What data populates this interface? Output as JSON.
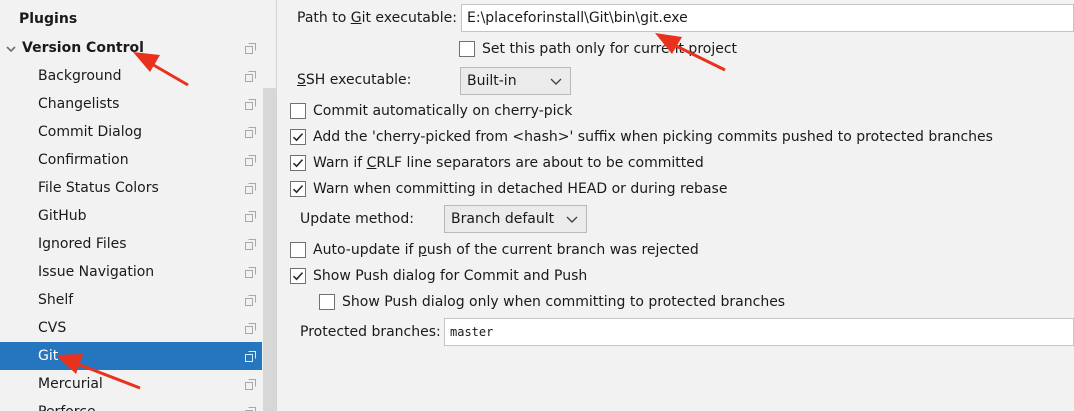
{
  "sidebar": {
    "plugins_label": "Plugins",
    "version_control_label": "Version Control",
    "items": [
      {
        "label": "Background"
      },
      {
        "label": "Changelists"
      },
      {
        "label": "Commit Dialog"
      },
      {
        "label": "Confirmation"
      },
      {
        "label": "File Status Colors"
      },
      {
        "label": "GitHub"
      },
      {
        "label": "Ignored Files"
      },
      {
        "label": "Issue Navigation"
      },
      {
        "label": "Shelf"
      },
      {
        "label": "CVS"
      },
      {
        "label": "Git",
        "selected": true
      },
      {
        "label": "Mercurial"
      },
      {
        "label": "Perforce"
      }
    ]
  },
  "git": {
    "path_label_prefix": "Path to ",
    "path_label_mnemonic": "G",
    "path_label_suffix": "it executable:",
    "path_value": "E:\\placeforinstall\\Git\\bin\\git.exe",
    "path_current_project_only": {
      "label": "Set this path only for current project",
      "checked": false
    },
    "ssh_label_mnemonic": "S",
    "ssh_label_suffix": "SH executable:",
    "ssh_value": "Built-in",
    "commit_auto_cherry_pick": {
      "label": "Commit automatically on cherry-pick",
      "checked": false
    },
    "cherry_picked_suffix": {
      "label": "Add the 'cherry-picked from <hash>' suffix when picking commits pushed to protected branches",
      "checked": true
    },
    "crlf_warn": {
      "label_prefix": "Warn if ",
      "label_mnemonic": "C",
      "label_suffix": "RLF line separators are about to be committed",
      "checked": true
    },
    "detached_head_warn": {
      "label": "Warn when committing in detached HEAD or during rebase",
      "checked": true
    },
    "update_method_label": "Update method:",
    "update_method_value": "Branch default",
    "auto_update_push_rejected": {
      "label_prefix": "Auto-update if ",
      "label_mnemonic": "p",
      "label_suffix": "ush of the current branch was rejected",
      "checked": false
    },
    "show_push_dialog": {
      "label": "Show Push dialog for Commit and Push",
      "checked": true
    },
    "show_push_dialog_protected_only": {
      "label": "Show Push dialog only when committing to protected branches",
      "checked": false
    },
    "protected_branches_label": "Protected branches:",
    "protected_branches_value": "master"
  },
  "colors": {
    "selection": "#2675bf",
    "annotation_arrow": "#e8321e"
  }
}
